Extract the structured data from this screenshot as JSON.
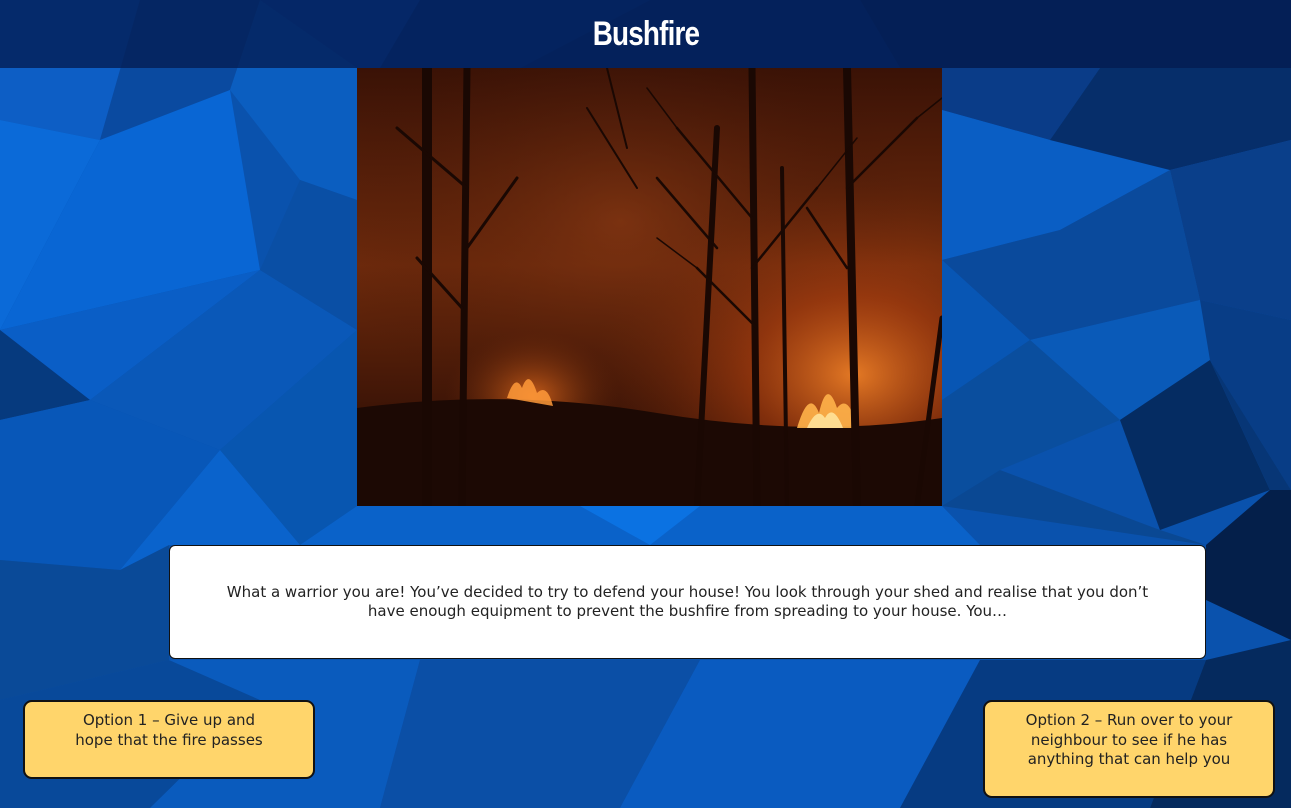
{
  "header": {
    "title": "Bushfire"
  },
  "scene": {
    "image_alt": "Bushfire burning among trees at night"
  },
  "story": {
    "text": "What a warrior you are! You’ve decided to try to defend your house! You look through your shed and realise that you don’t have enough equipment to prevent the bushfire from spreading to your house. You…"
  },
  "options": [
    {
      "label": "Option 1 – Give up and hope that the fire passes"
    },
    {
      "label": "Option 2 – Run over to your neighbour to see if he has anything that can help you"
    }
  ],
  "colors": {
    "header_bg": "#041c52",
    "option_bg": "#ffd56b",
    "story_bg": "#ffffff",
    "background_blue": "#0a4fa8"
  }
}
